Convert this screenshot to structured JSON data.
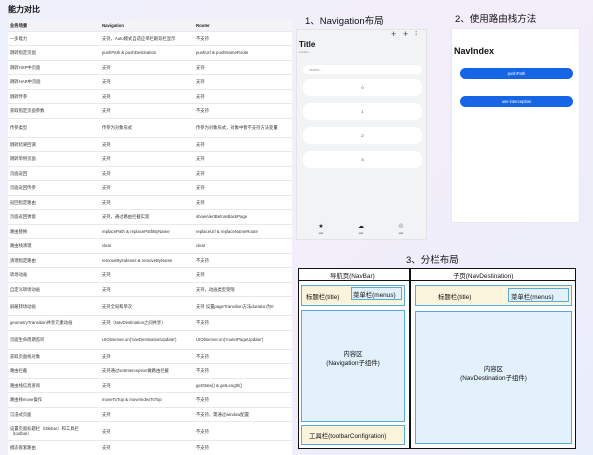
{
  "comparison": {
    "title": "能力对比",
    "headers": [
      "业务场景",
      "Navigation",
      "Router"
    ],
    "rows": [
      [
        "一多能力",
        "支持，Auto模式自适应单栏跟双栏显示",
        "不支持"
      ],
      [
        "跳转指定页面",
        "pushPath & pushDestination",
        "pushUrl & pushNameRoute"
      ],
      [
        "跳转HSP中页面",
        "支持",
        "支持"
      ],
      [
        "跳转HAR中页面",
        "支持",
        "支持"
      ],
      [
        "跳转传参",
        "支持",
        "支持"
      ],
      [
        "获取指定页面参数",
        "支持",
        "不支持"
      ],
      [
        "传参类型",
        "传参为对象形式",
        "传参为对象形式，对象中暂不支持方法变量"
      ],
      [
        "跳转结果回调",
        "支持",
        "支持"
      ],
      [
        "跳转单例页面",
        "支持",
        "支持"
      ],
      [
        "页面返回",
        "支持",
        "支持"
      ],
      [
        "页面返回传参",
        "支持",
        "支持"
      ],
      [
        "返回指定路由",
        "支持",
        "支持"
      ],
      [
        "页面返回弹窗",
        "支持，通过路由拦截实现",
        "showAlertBeforeBackPage"
      ],
      [
        "路由替换",
        "replacePath & replacePathByName",
        "replaceUrl & replaceNameRoute"
      ],
      [
        "路由栈清理",
        "clear",
        "clear"
      ],
      [
        "清理指定路由",
        "removeByIndexes & removeByName",
        "不支持"
      ],
      [
        "转场动画",
        "支持",
        "支持"
      ],
      [
        "自定义转场动画",
        "支持",
        "支持，动画类型受限"
      ],
      [
        "屏蔽转场动画",
        "支持全局和单次",
        "支持 设置pageTransition方法duration为0"
      ],
      [
        "geometryTransition共享元素动画",
        "支持（NavDestination之间共享）",
        "不支持"
      ],
      [
        "页面生命周期监听",
        "UIObserver.on('navDestinationUpdate')",
        "UIObserver.on('routerPageUpdate')"
      ],
      [
        "获取页面栈对象",
        "支持",
        "不支持"
      ],
      [
        "路由拦截",
        "支持通过setInterception做路由拦截",
        "不支持"
      ],
      [
        "路由栈信息查询",
        "支持",
        "getState() & getLength()"
      ],
      [
        "路由栈move操作",
        "moveToTop & moveIndexToTop",
        "不支持"
      ],
      [
        "沉浸式页面",
        "支持",
        "不支持，需通过window配置"
      ],
      [
        "设置页面标题栏（titlebar）和工具栏（toolbar）",
        "支持",
        "不支持"
      ],
      [
        "模态嵌套路由",
        "支持",
        "不支持"
      ]
    ]
  },
  "navigation_demo": {
    "heading": "1、Navigation布局",
    "title": "Title",
    "subtitle": "subtitle",
    "actions": [
      "+",
      "+",
      "⁝"
    ],
    "search_placeholder": "search...",
    "items": [
      "0",
      "1",
      "2",
      "3"
    ],
    "tabs": [
      {
        "icon": "★",
        "label": "star"
      },
      {
        "icon": "☁",
        "label": "star"
      },
      {
        "icon": "♲",
        "label": "star"
      }
    ]
  },
  "router_demo": {
    "heading": "2、使用路由栈方法",
    "title": "NavIndex",
    "buttons": [
      "pushPath",
      "use interception"
    ]
  },
  "split_layout": {
    "heading": "3、分栏布局",
    "navbar": {
      "label": "导航页(NavBar)",
      "titlebar": "标题栏(title)",
      "menus": "菜单栏(menus)",
      "content": "内容区\n(Navigation子组件)",
      "toolbar": "工具栏(toolbarConfigration)"
    },
    "destination": {
      "label": "子页(NavDestination)",
      "titlebar": "标题栏(title)",
      "menus": "菜单栏(menus)",
      "content": "内容区\n(NavDestination子组件)"
    }
  }
}
